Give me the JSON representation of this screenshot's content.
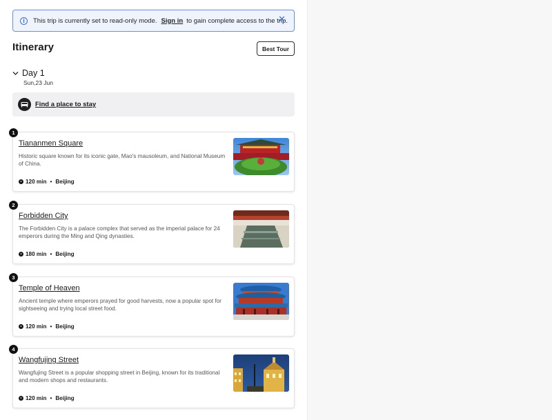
{
  "banner": {
    "message": "This trip is currently set to read-only mode.",
    "signin_label": "Sign in",
    "message_suffix": "to gain complete access to the trip."
  },
  "header": {
    "title": "Itinerary",
    "best_tour_label": "Best Tour"
  },
  "day": {
    "title": "Day 1",
    "date": "Sun,23 Jun",
    "stay_label": "Find a place to stay"
  },
  "places": [
    {
      "number": "1",
      "title": "Tiananmen Square",
      "description": "Historic square known for its iconic gate, Mao's mausoleum, and National Museum of China.",
      "duration": "120 min",
      "city": "Beijing"
    },
    {
      "number": "2",
      "title": "Forbidden City",
      "description": "The Forbidden City is a palace complex that served as the imperial palace for 24 emperors during the Ming and Qing dynasties.",
      "duration": "180 min",
      "city": "Beijing"
    },
    {
      "number": "3",
      "title": "Temple of Heaven",
      "description": "Ancient temple where emperors prayed for good harvests, now a popular spot for sightseeing and trying local street food.",
      "duration": "120 min",
      "city": "Beijing"
    },
    {
      "number": "4",
      "title": "Wangfujing Street",
      "description": "Wangfujing Street is a popular shopping street in Beijing, known for its traditional and modern shops and restaurants.",
      "duration": "120 min",
      "city": "Beijing"
    }
  ],
  "meta_separator": "•",
  "colors": {
    "banner_bg": "#eef3fc",
    "banner_border": "#6b8fd6",
    "accent_blue": "#3b6fd4",
    "badge": "#111111",
    "stay_bg": "#f0f0f2"
  },
  "icons": {
    "info": "info-icon",
    "close": "close-icon",
    "chevron": "chevron-down-icon",
    "bed": "bed-icon",
    "clock": "clock-icon"
  }
}
